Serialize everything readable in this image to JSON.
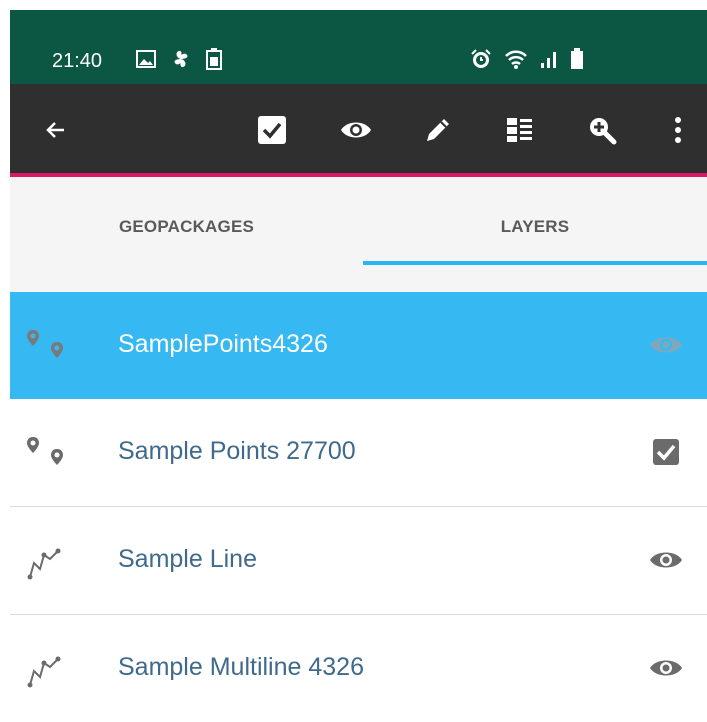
{
  "status_bar": {
    "time": "21:40",
    "left_icons": [
      "image-icon",
      "fan-icon",
      "battery-saver-icon"
    ],
    "right_icons": [
      "alarm-icon",
      "wifi-icon",
      "signal-icon",
      "battery-icon"
    ],
    "background": "#0b5743"
  },
  "toolbar": {
    "background": "#2f2f2f",
    "accent": "#d81b60",
    "actions": [
      "back-icon",
      "select-all-checkbox-icon",
      "visibility-icon",
      "edit-icon",
      "layer-list-icon",
      "zoom-in-icon",
      "more-vert-icon"
    ]
  },
  "tabs": [
    {
      "label": "GEOPACKAGES",
      "active": false
    },
    {
      "label": "LAYERS",
      "active": true
    }
  ],
  "layers": [
    {
      "name": "SamplePoints4326",
      "type_icon": "points-icon",
      "action_icon": "visibility-icon",
      "selected": true
    },
    {
      "name": "Sample Points 27700",
      "type_icon": "points-icon",
      "action_icon": "checkbox-checked-icon",
      "selected": false
    },
    {
      "name": "Sample Line",
      "type_icon": "line-icon",
      "action_icon": "visibility-icon",
      "selected": false
    },
    {
      "name": "Sample Multiline 4326",
      "type_icon": "line-icon",
      "action_icon": "visibility-icon",
      "selected": false
    }
  ],
  "colors": {
    "selected_row": "#36b9f2",
    "tab_indicator": "#29b6f6",
    "layer_text": "#3f6a8c"
  }
}
